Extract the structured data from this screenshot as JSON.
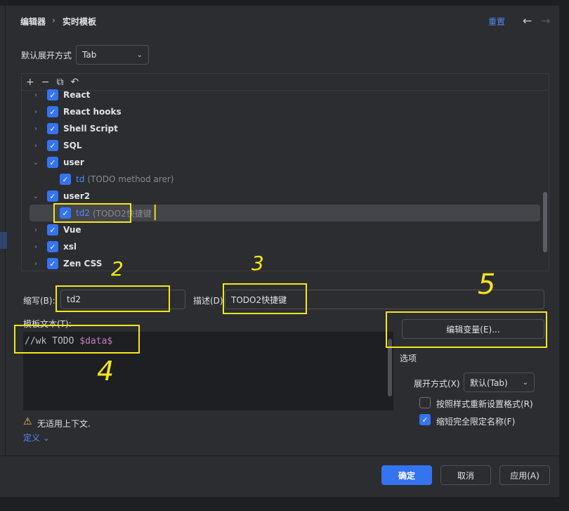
{
  "breadcrumb": {
    "parent": "编辑器",
    "sep": "›",
    "current": "实时模板"
  },
  "header": {
    "reset": "重置",
    "back": "←",
    "forward": "→"
  },
  "expand_default": {
    "label": "默认展开方式",
    "value": "Tab"
  },
  "toolbar": {
    "add": "+",
    "remove": "−",
    "copy": "⧉",
    "revert": "↶"
  },
  "tree": [
    {
      "name": "React"
    },
    {
      "name": "React hooks"
    },
    {
      "name": "Shell Script"
    },
    {
      "name": "SQL"
    },
    {
      "name": "user"
    },
    {
      "name": "td",
      "desc": "(TODO method arer)"
    },
    {
      "name": "user2"
    },
    {
      "name": "td2",
      "desc": "(TODO2快捷键"
    },
    {
      "name": "Vue"
    },
    {
      "name": "xsl"
    },
    {
      "name": "Zen CSS"
    }
  ],
  "abbrev": {
    "label": "缩写(B):",
    "value": "td2"
  },
  "description": {
    "label": "描述(D)",
    "value": "TODO2快捷键"
  },
  "template_text": {
    "label": "模板文本(T):",
    "plain": "//wk TODO ",
    "variable": "$data$"
  },
  "edit_vars": "编辑变量(E)...",
  "options": {
    "title": "选项",
    "expand_label": "展开方式(X)",
    "expand_value": "默认(Tab)",
    "reformat": "按照样式重新设置格式(R)",
    "shorten": "缩短完全限定名称(F)"
  },
  "warning": {
    "icon": "⚠",
    "text": "无适用上下文."
  },
  "define": "定义 ⌄",
  "buttons": {
    "ok": "确定",
    "cancel": "取消",
    "apply": "应用(A)"
  },
  "annotations": {
    "n1": "|",
    "n2": "2",
    "n3": "3",
    "n4": "4",
    "n5": "5"
  },
  "colors": {
    "accent": "#3574f0",
    "annotation": "#f5e61c",
    "link": "#548af7",
    "variable": "#c77dbb"
  }
}
